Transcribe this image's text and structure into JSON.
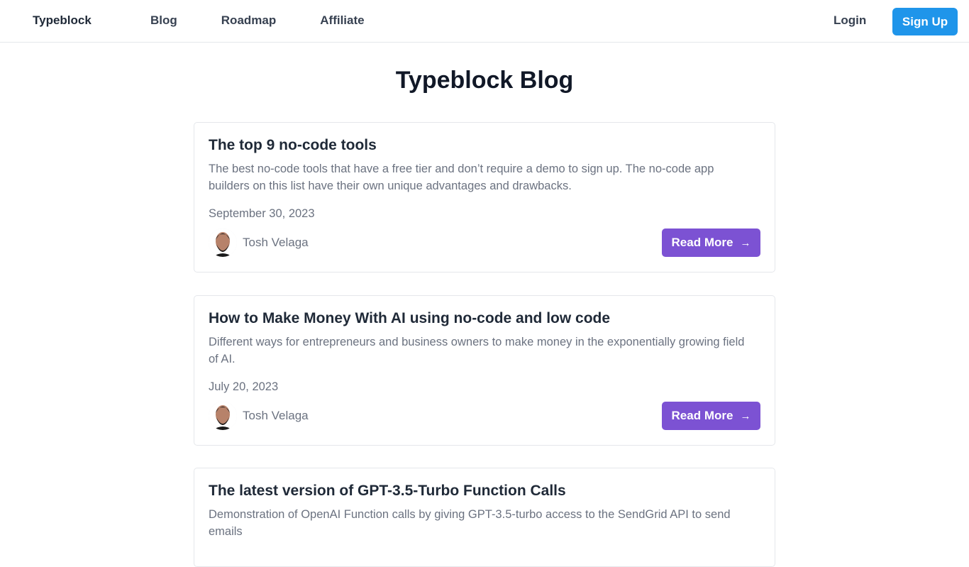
{
  "nav": {
    "brand": "Typeblock",
    "links": [
      "Blog",
      "Roadmap",
      "Affiliate"
    ],
    "login": "Login",
    "signup": "Sign Up"
  },
  "page": {
    "title": "Typeblock Blog"
  },
  "posts": [
    {
      "title": "The top 9 no-code tools",
      "excerpt": "The best no-code tools that have a free tier and don’t require a demo to sign up. The no-code app builders on this list have their own unique advantages and drawbacks.",
      "date": "September 30, 2023",
      "author": "Tosh Velaga",
      "button": "Read More"
    },
    {
      "title": "How to Make Money With AI using no-code and low code",
      "excerpt": "Different ways for entrepreneurs and business owners to make money in the exponentially growing field of AI.",
      "date": "July 20, 2023",
      "author": "Tosh Velaga",
      "button": "Read More"
    },
    {
      "title": "The latest version of GPT-3.5-Turbo Function Calls",
      "excerpt": "Demonstration of OpenAI Function calls by giving GPT-3.5-turbo access to the SendGrid API to send emails",
      "date": "",
      "author": "",
      "button": ""
    }
  ],
  "icons": {
    "arrow": "arrow-right-icon",
    "avatar": "avatar-icon"
  },
  "colors": {
    "signup": "#1f95ea",
    "readmore": "#7c52d3"
  }
}
